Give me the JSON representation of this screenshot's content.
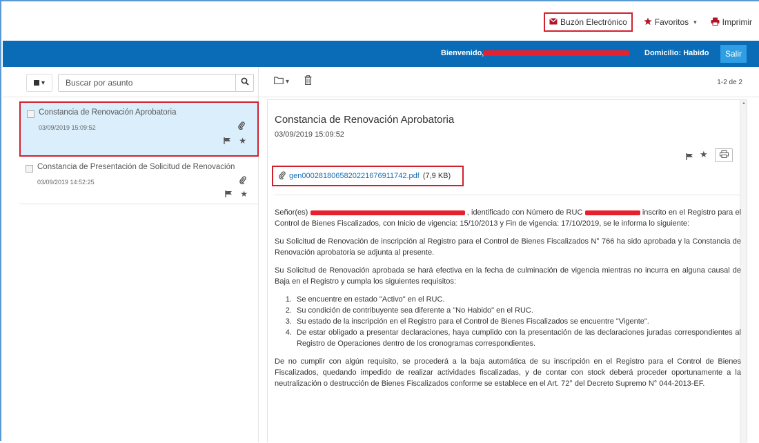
{
  "topmenu": {
    "mailbox_label": "Buzón Electrónico",
    "favorites_label": "Favoritos",
    "print_label": "Imprimir"
  },
  "nav": {
    "welcome_label": "Bienvenido,",
    "domicile_label": "Domicilio: Habido",
    "logout_label": "Salir"
  },
  "search": {
    "placeholder": "Buscar por asunto"
  },
  "messages": [
    {
      "subject": "Constancia de Renovación Aprobatoria",
      "date": "03/09/2019 15:09:52"
    },
    {
      "subject": "Constancia de Presentación de Solicitud de Renovación",
      "date": "03/09/2019 14:52:25"
    }
  ],
  "pager": {
    "text": "1-2 de 2"
  },
  "reader": {
    "title": "Constancia de Renovación Aprobatoria",
    "date": "03/09/2019 15:09:52",
    "attachment_name": "gen0002818065820221676911742.pdf",
    "attachment_size": "(7,9 KB)",
    "p1_a": "Señor(es)",
    "p1_b": ", identificado con Número de RUC",
    "p1_c": "inscrito en el Registro para el Control de Bienes Fiscalizados, con Inicio de vigencia: 15/10/2013 y Fin de vigencia: 17/10/2019, se le informa lo siguiente:",
    "p2": "Su Solicitud de Renovación de inscripción al Registro para el Control de Bienes Fiscalizados N° 766 ha sido aprobada y la Constancia de Renovación aprobatoria se adjunta al presente.",
    "p3": "Su Solicitud de Renovación aprobada se hará efectiva en la fecha de culminación de vigencia mientras no incurra en alguna causal de Baja en el Registro y cumpla los siguientes requisitos:",
    "req1": "Se encuentre en estado \"Activo\" en el RUC.",
    "req2": "Su condición de contribuyente sea diferente a \"No Habido\" en el RUC.",
    "req3": "Su estado de la inscripción en el Registro para el Control de Bienes Fiscalizados se encuentre \"Vigente\".",
    "req4": "De estar obligado a presentar declaraciones, haya cumplido con la presentación de las declaraciones juradas correspondientes al Registro de Operaciones dentro de los cronogramas correspondientes.",
    "p4": "De no cumplir con algún requisito, se procederá a la baja automática de su inscripción en el Registro para el Control de Bienes Fiscalizados, quedando impedido de realizar actividades fiscalizadas, y de contar con stock deberá proceder oportunamente a la neutralización o destrucción de Bienes Fiscalizados conforme se establece en el Art. 72° del Decreto Supremo N° 044-2013-EF."
  },
  "colors": {
    "nav_blue": "#0a6bb6",
    "logout_blue": "#2f9ee3",
    "selected_row": "#dbeefb",
    "highlight_red": "#d0202e",
    "link_blue": "#1a6fb6"
  }
}
